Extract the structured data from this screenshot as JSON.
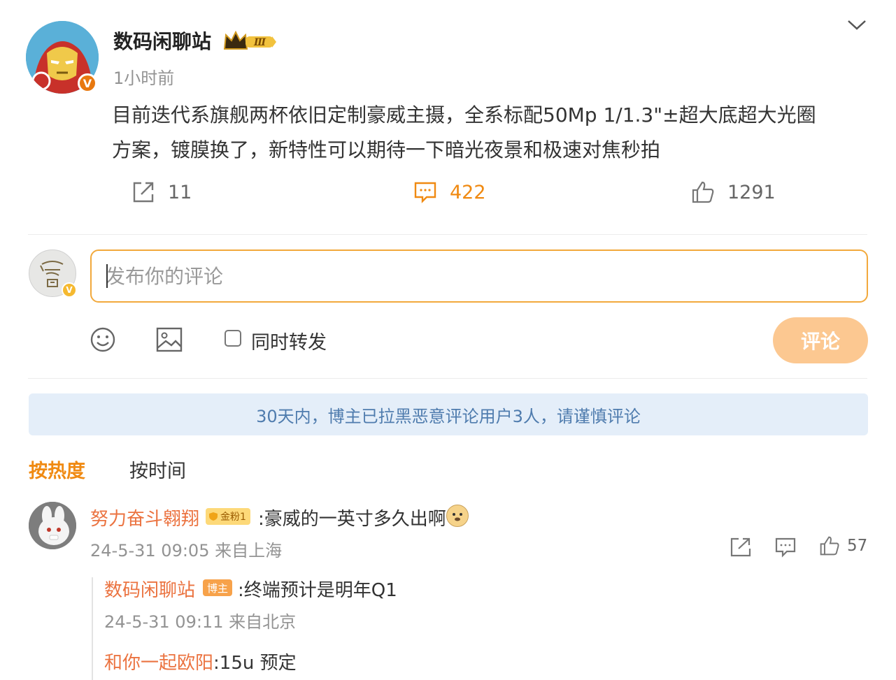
{
  "post": {
    "author": "数码闲聊站",
    "level_badge": "Ⅲ",
    "time": "1小时前",
    "text_line1": "目前迭代系旗舰两杯依旧定制豪威主摄，全系标配50Mp 1/1.3\"±超大底超大光圈",
    "text_line2": "方案，镀膜换了，新特性可以期待一下暗光夜景和极速对焦秒拍",
    "repost_count": "11",
    "comment_count": "422",
    "like_count": "1291",
    "verified_mark": "V"
  },
  "compose": {
    "placeholder": "发布你的评论",
    "also_repost_label": "同时转发",
    "submit_label": "评论"
  },
  "notice": "30天内，博主已拉黑恶意评论用户3人，请谨慎评论",
  "sort": {
    "hot": "按热度",
    "time": "按时间"
  },
  "comments": [
    {
      "name": "努力奋斗翱翔",
      "fan_badge": "金粉1",
      "text": ":豪威的一英寸多久出啊",
      "meta": "24-5-31 09:05 来自上海",
      "likes": "57",
      "replies": [
        {
          "name": "数码闲聊站",
          "badge": "博主",
          "text": ":终端预计是明年Q1",
          "meta": "24-5-31 09:11 来自北京"
        },
        {
          "name": "和你一起欧阳",
          "text": ":15u 预定"
        }
      ]
    }
  ],
  "colors": {
    "accent": "#f08a12",
    "username": "#eb7340",
    "notice_bg": "#e4eef9",
    "notice_text": "#4f7cae",
    "submit_bg": "#fcc891"
  },
  "icons": [
    "chevron-down-icon",
    "repost-icon",
    "comment-icon",
    "like-icon",
    "emoji-icon",
    "image-icon",
    "share-icon"
  ]
}
